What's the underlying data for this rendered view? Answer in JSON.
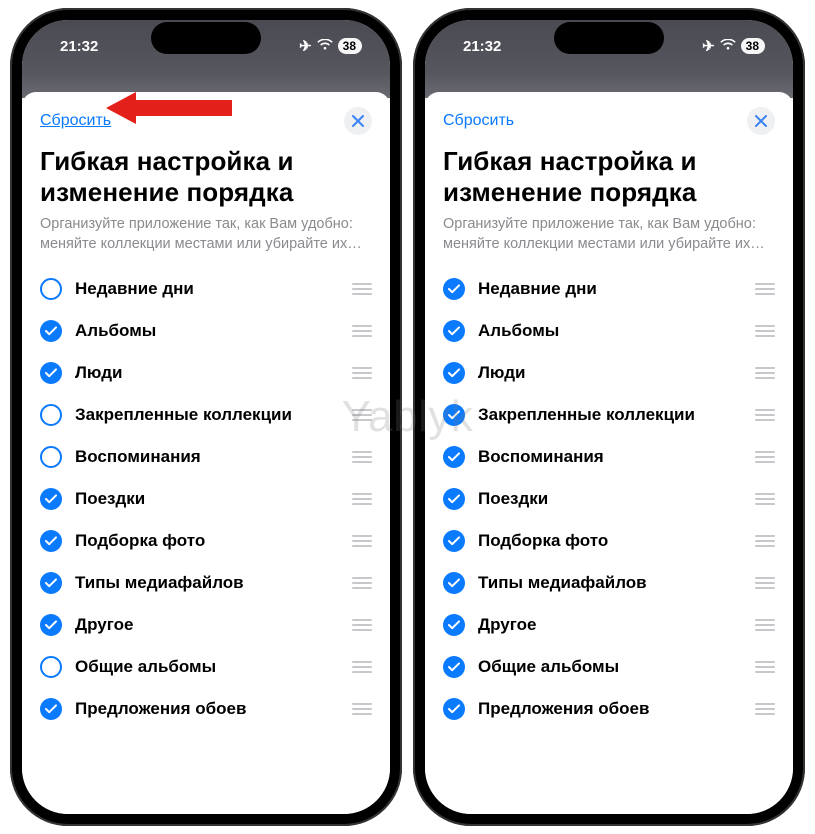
{
  "status": {
    "time": "21:32",
    "battery": "38"
  },
  "sheet": {
    "reset": "Сбросить",
    "title": "Гибкая настройка и изменение порядка",
    "subtitle": "Организуйте приложение так, как Вам удобно: меняйте коллекции местами или убирайте их…"
  },
  "items": [
    {
      "label": "Недавние дни"
    },
    {
      "label": "Альбомы"
    },
    {
      "label": "Люди"
    },
    {
      "label": "Закрепленные коллекции"
    },
    {
      "label": "Воспоминания"
    },
    {
      "label": "Поездки"
    },
    {
      "label": "Подборка фото"
    },
    {
      "label": "Типы медиафайлов"
    },
    {
      "label": "Другое"
    },
    {
      "label": "Общие альбомы"
    },
    {
      "label": "Предложения обоев"
    }
  ],
  "left_checked": [
    false,
    true,
    true,
    false,
    false,
    true,
    true,
    true,
    true,
    false,
    true
  ],
  "right_checked": [
    true,
    true,
    true,
    true,
    true,
    true,
    true,
    true,
    true,
    true,
    true
  ],
  "watermark": "Yablyk"
}
